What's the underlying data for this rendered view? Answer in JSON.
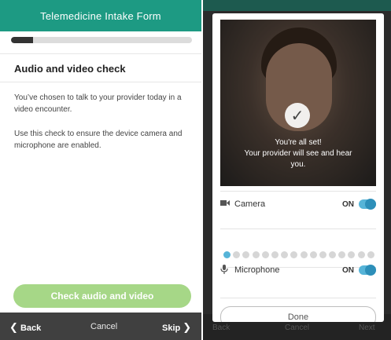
{
  "intake": {
    "header_title": "Telemedicine Intake Form",
    "progress_fraction": 0.12,
    "section_title": "Audio and video check",
    "paragraph1": "You’ve chosen to talk to your provider today in a video encounter.",
    "paragraph2": "Use this check to ensure the device camera and microphone are enabled.",
    "check_button_label": "Check audio and video",
    "footer": {
      "back_label": "Back",
      "cancel_label": "Cancel",
      "skip_label": "Skip"
    }
  },
  "dimmed_footer": {
    "back_label": "Back",
    "cancel_label": "Cancel",
    "next_label": "Next"
  },
  "modal": {
    "status_line1": "You're all set!",
    "status_line2": "Your provider will see and hear",
    "status_line3": "you.",
    "camera": {
      "label": "Camera",
      "state": "ON",
      "icon": "video-camera-icon"
    },
    "mic_level": {
      "active_dots": 1,
      "total_dots": 16
    },
    "microphone": {
      "label": "Microphone",
      "state": "ON",
      "icon": "microphone-icon"
    },
    "done_label": "Done"
  },
  "colors": {
    "header_green": "#1d9a83",
    "button_green": "#a6d787",
    "toggle_blue": "#2d8fb9",
    "footer_dark": "#404040"
  }
}
